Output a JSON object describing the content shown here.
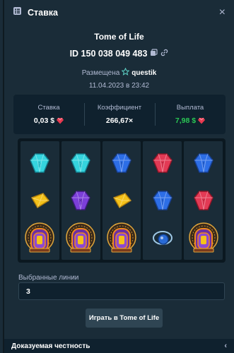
{
  "modal": {
    "title": "Ставка",
    "close_glyph": "×",
    "game_name": "Tome of Life",
    "bet_id": "ID 150 038 049 483",
    "placed_label": "Размещена",
    "username": "questik",
    "date": "11.04.2023 в 23:42"
  },
  "stats": {
    "bet_label": "Ставка",
    "bet_value": "0,03 $",
    "multiplier_label": "Коэффициент",
    "multiplier_value": "266,67×",
    "payout_label": "Выплата",
    "payout_value": "7,98 $"
  },
  "reels": [
    [
      "cyan-gem",
      "gold-gem",
      "tome-door"
    ],
    [
      "cyan-gem",
      "purple-gem",
      "tome-door"
    ],
    [
      "blue-gem",
      "gold-gem",
      "tome-door"
    ],
    [
      "red-gem",
      "blue-gem",
      "blue-amulet"
    ],
    [
      "blue-gem",
      "red-gem",
      "tome-door"
    ]
  ],
  "lines": {
    "label": "Выбранные линии",
    "value": "3"
  },
  "play_button": "Играть в Tome of Life",
  "footer": {
    "fairness_label": "Доказуемая честность",
    "chevron": "‹"
  },
  "colors": {
    "modal_bg": "#1a2c38",
    "dark_panel": "#0f212e",
    "muted_text": "#b1bad3",
    "win_green": "#2ac754",
    "button_bg": "#2f4553"
  }
}
